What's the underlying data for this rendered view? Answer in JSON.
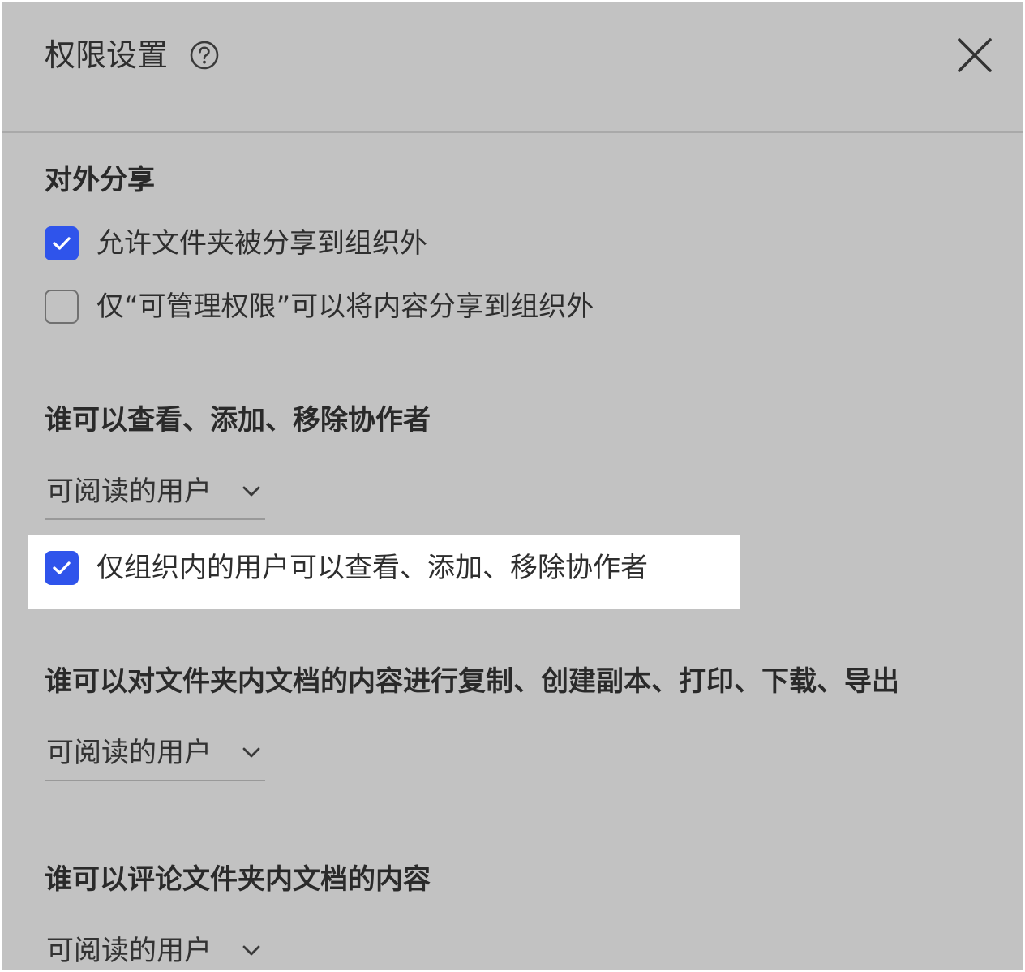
{
  "dialog": {
    "title": "权限设置",
    "help_icon": "question-circle-icon",
    "close_icon": "close-icon"
  },
  "external_share": {
    "title": "对外分享",
    "options": [
      {
        "label": "允许文件夹被分享到组织外",
        "checked": true
      },
      {
        "label": "仅“可管理权限”可以将内容分享到组织外",
        "checked": false
      }
    ]
  },
  "collaborators": {
    "title": "谁可以查看、添加、移除协作者",
    "selected": "可阅读的用户",
    "option": {
      "label": "仅组织内的用户可以查看、添加、移除协作者",
      "checked": true
    }
  },
  "copy_permission": {
    "title": "谁可以对文件夹内文档的内容进行复制、创建副本、打印、下载、导出",
    "selected": "可阅读的用户"
  },
  "comment_permission": {
    "title": "谁可以评论文件夹内文档的内容",
    "selected": "可阅读的用户"
  },
  "colors": {
    "panel_background": "#c2c2c2",
    "checkbox_checked": "#2f54eb",
    "highlight": "#ffffff"
  }
}
